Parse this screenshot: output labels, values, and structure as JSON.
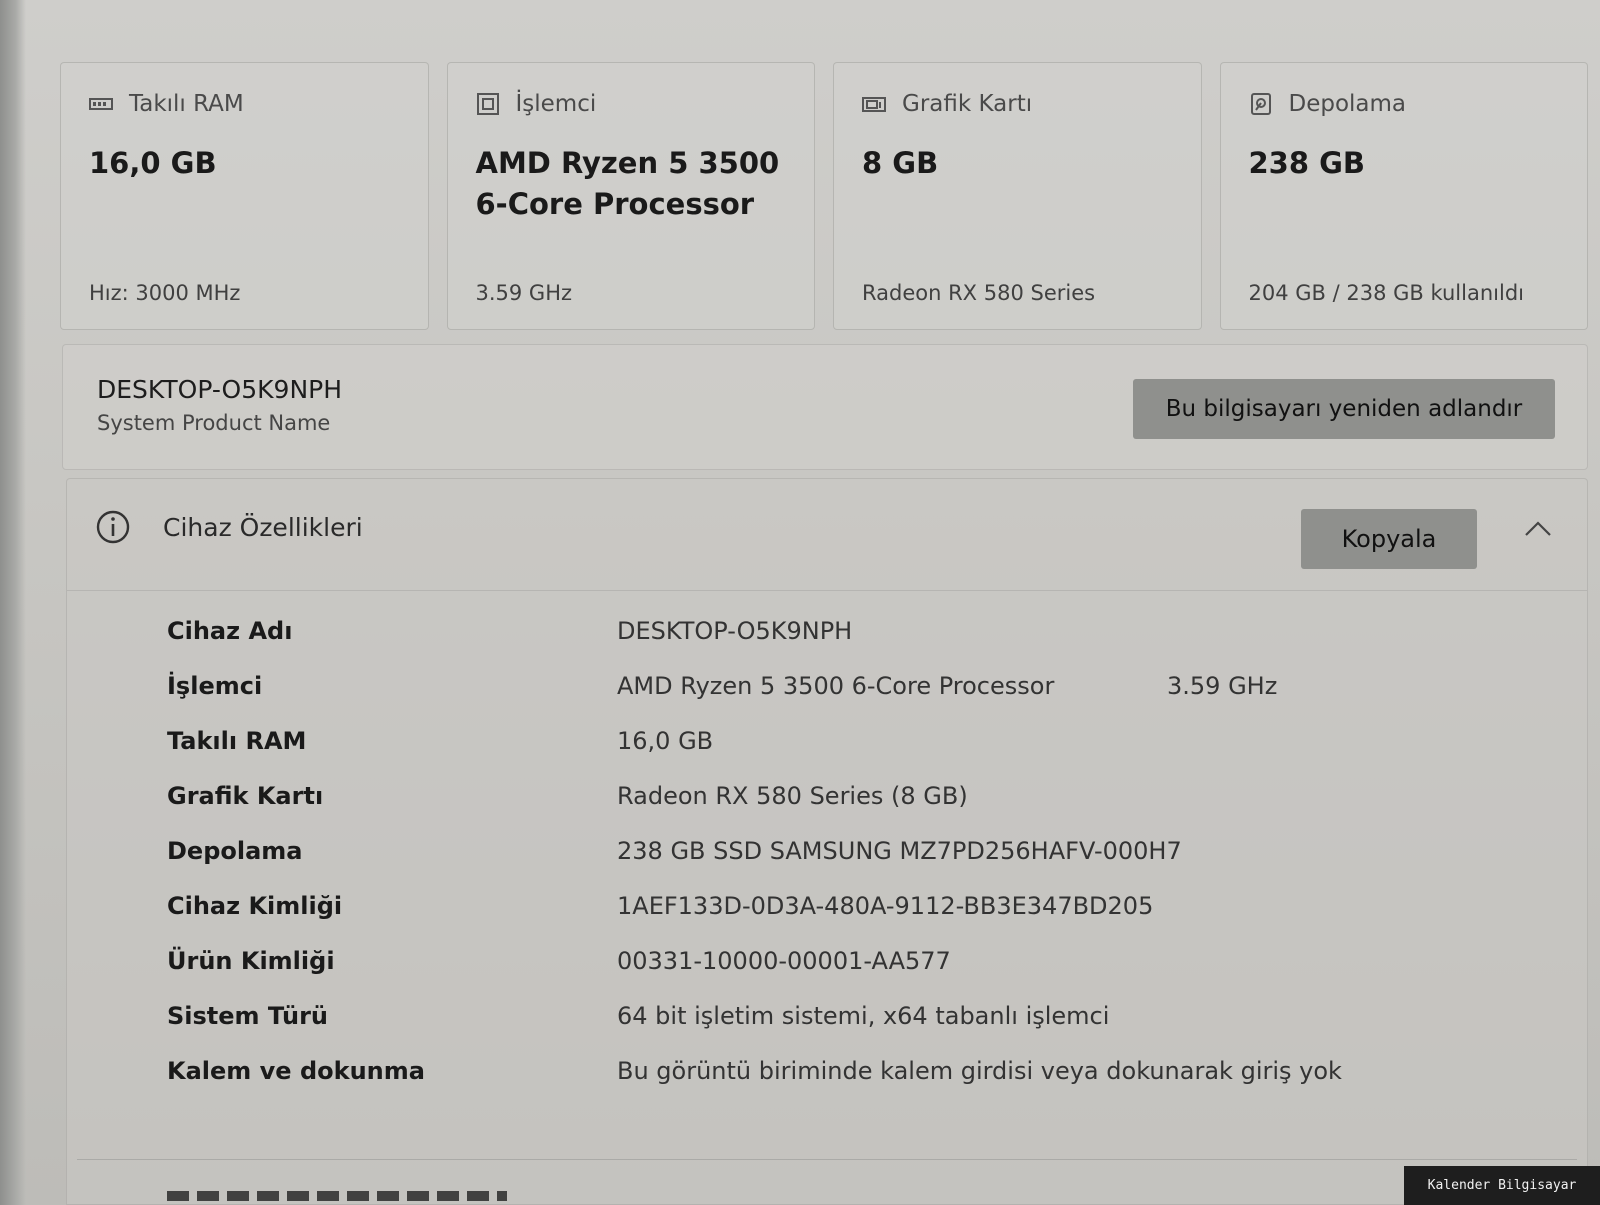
{
  "spec_cards": [
    {
      "icon": "ram-icon",
      "title": "Takılı RAM",
      "value": "16,0 GB",
      "sub": "Hız: 3000 MHz"
    },
    {
      "icon": "processor-icon",
      "title": "İşlemci",
      "value": "AMD Ryzen 5 3500 6-Core Processor",
      "sub": "3.59 GHz"
    },
    {
      "icon": "graphics-card-icon",
      "title": "Grafik Kartı",
      "value": "8 GB",
      "sub": "Radeon RX 580 Series"
    },
    {
      "icon": "storage-icon",
      "title": "Depolama",
      "value": "238 GB",
      "sub": "204 GB / 238 GB kullanıldı"
    }
  ],
  "device": {
    "name": "DESKTOP-O5K9NPH",
    "model": "System Product Name",
    "rename_button": "Bu bilgisayarı yeniden adlandır"
  },
  "properties": {
    "icon": "info-icon",
    "title": "Cihaz Özellikleri",
    "copy_button": "Kopyala",
    "collapse_icon": "chevron-up-icon",
    "rows": [
      {
        "label": "Cihaz Adı",
        "value": "DESKTOP-O5K9NPH",
        "extra": ""
      },
      {
        "label": "İşlemci",
        "value": "AMD Ryzen 5 3500 6-Core Processor",
        "extra": "3.59 GHz"
      },
      {
        "label": "Takılı RAM",
        "value": "16,0 GB",
        "extra": ""
      },
      {
        "label": "Grafik Kartı",
        "value": "Radeon RX 580 Series (8 GB)",
        "extra": ""
      },
      {
        "label": "Depolama",
        "value": "238 GB SSD SAMSUNG MZ7PD256HAFV-000H7",
        "extra": ""
      },
      {
        "label": "Cihaz Kimliği",
        "value": "1AEF133D-0D3A-480A-9112-BB3E347BD205",
        "extra": ""
      },
      {
        "label": "Ürün Kimliği",
        "value": "00331-10000-00001-AA577",
        "extra": ""
      },
      {
        "label": "Sistem Türü",
        "value": "64 bit işletim sistemi, x64 tabanlı işlemci",
        "extra": ""
      },
      {
        "label": "Kalem ve dokunma",
        "value": "Bu görüntü biriminde kalem girdisi veya dokunarak giriş yok",
        "extra": ""
      }
    ]
  },
  "watermark": "Kalender Bilgisayar"
}
